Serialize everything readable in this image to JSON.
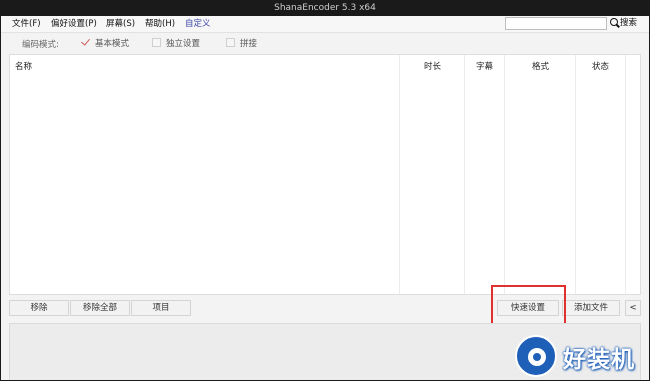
{
  "window": {
    "title": "ShanaEncoder 5.3 x64"
  },
  "menu": {
    "items": [
      "文件(F)",
      "偏好设置(P)",
      "屏幕(S)",
      "帮助(H)",
      "自定义"
    ]
  },
  "search": {
    "value": "",
    "button_label": "搜索"
  },
  "mode": {
    "label": "编码模式:",
    "options": [
      {
        "label": "基本模式",
        "checked": true
      },
      {
        "label": "独立设置",
        "checked": false
      },
      {
        "label": "拼接",
        "checked": false
      }
    ]
  },
  "list": {
    "columns": [
      "名称",
      "时长",
      "字幕",
      "格式",
      "状态"
    ]
  },
  "buttons": {
    "remove": "移除",
    "remove_all": "移除全部",
    "item": "项目",
    "quick_settings": "快速设置",
    "add_file": "添加文件",
    "collapse": "<"
  },
  "watermark": {
    "text": "好装机",
    "color": "#1e5fb8"
  },
  "colors": {
    "titlebar": "#1a1a1a",
    "accent_menu": "#3a44a8",
    "highlight": "#e03131",
    "check": "#d25a5a"
  }
}
